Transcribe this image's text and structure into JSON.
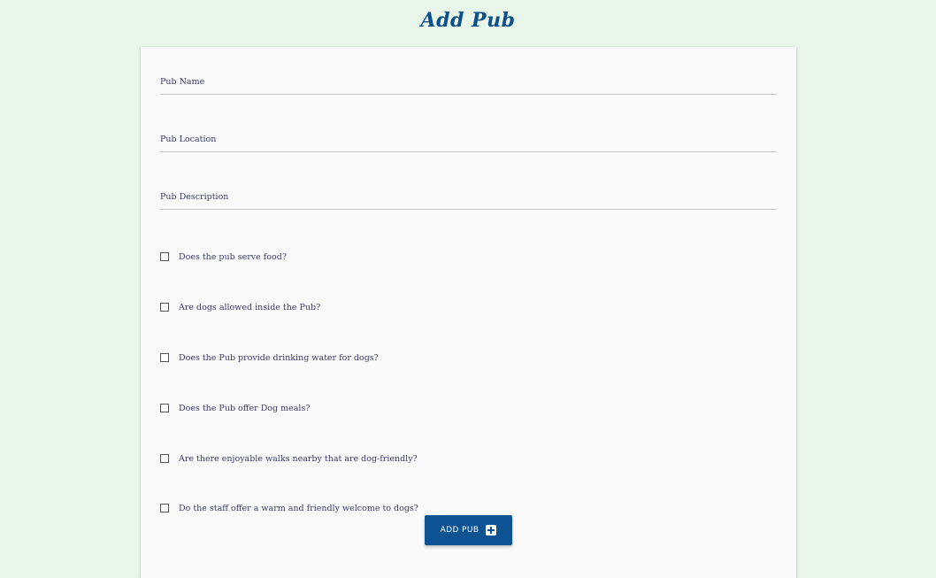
{
  "header": {
    "title": "Add Pub"
  },
  "form": {
    "fields": [
      {
        "label": "Pub Name",
        "value": ""
      },
      {
        "label": "Pub Location",
        "value": ""
      },
      {
        "label": "Pub Description",
        "value": ""
      }
    ],
    "checkboxes": [
      {
        "label": "Does the pub serve food?",
        "checked": false
      },
      {
        "label": "Are dogs allowed inside the Pub?",
        "checked": false
      },
      {
        "label": "Does the Pub provide drinking water for dogs?",
        "checked": false
      },
      {
        "label": "Does the Pub offer Dog meals?",
        "checked": false
      },
      {
        "label": "Are there enjoyable walks nearby that are dog-friendly?",
        "checked": false
      },
      {
        "label": "Do the staff offer a warm and friendly welcome to dogs?",
        "checked": false
      }
    ],
    "submit": {
      "label": "ADD PUB",
      "icon": "plus-box-icon"
    }
  },
  "colors": {
    "background": "#e8f5e9",
    "card": "#fafafa",
    "accent": "#0d5394",
    "title": "#0d4f8b",
    "label": "#3a3a6a"
  }
}
